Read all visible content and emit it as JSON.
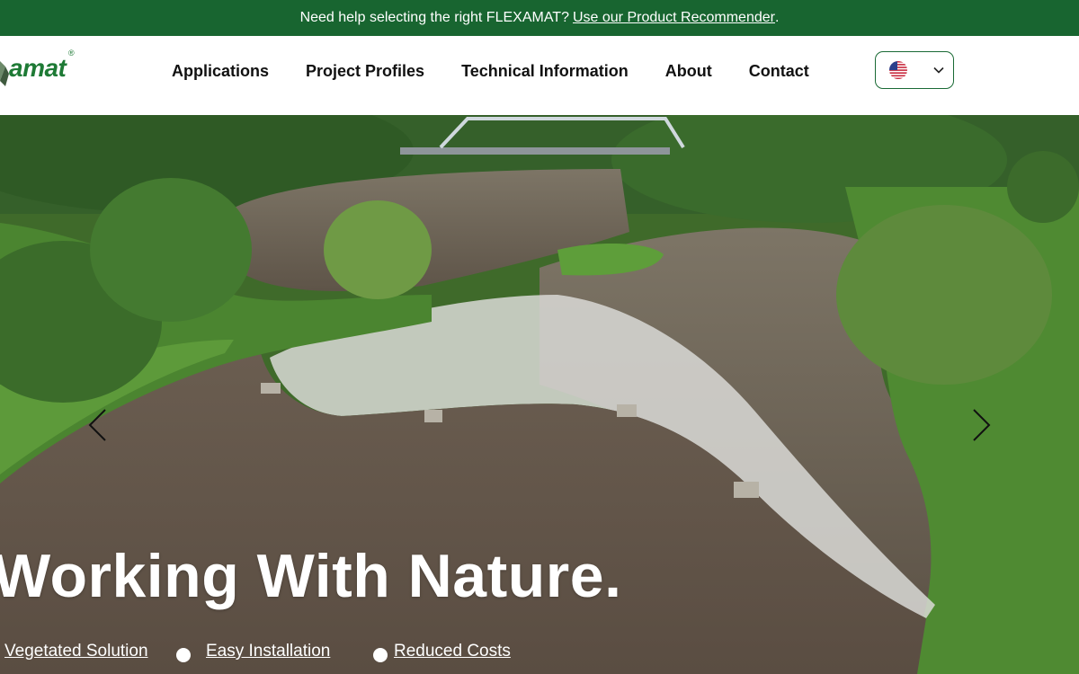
{
  "announcement": {
    "text": "Need help selecting the right FLEXAMAT?",
    "link_label": "Use our Product Recommender",
    "trailing": "."
  },
  "brand": {
    "logo_text": "amat",
    "logo_mark": "®",
    "color": "#1e7a35"
  },
  "nav": {
    "items": [
      {
        "label": "Applications"
      },
      {
        "label": "Project Profiles"
      },
      {
        "label": "Technical Information"
      },
      {
        "label": "About"
      },
      {
        "label": "Contact"
      }
    ]
  },
  "language": {
    "selected_icon": "us-flag-icon",
    "dropdown_icon": "chevron-down-icon"
  },
  "hero": {
    "headline": "Working With Nature.",
    "features": [
      {
        "label": "Vegetated Solution"
      },
      {
        "label": "Easy Installation"
      },
      {
        "label": "Reduced Costs"
      }
    ],
    "prev_icon": "chevron-left-icon",
    "next_icon": "chevron-right-icon"
  },
  "colors": {
    "topbar_bg": "#186530",
    "accent": "#1a6a35",
    "text": "#111111"
  }
}
